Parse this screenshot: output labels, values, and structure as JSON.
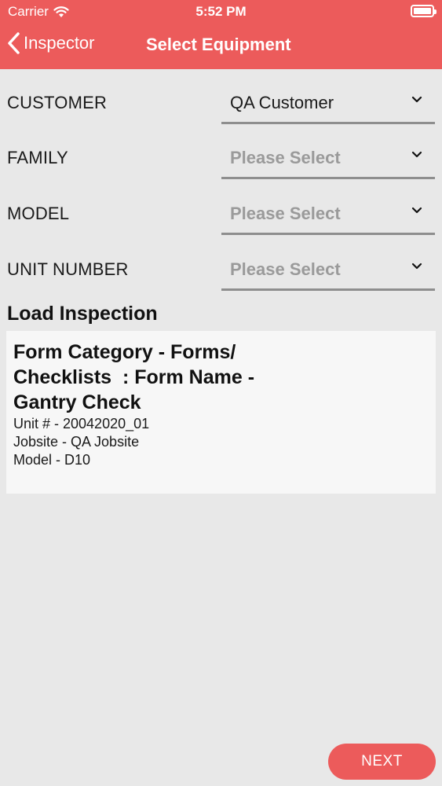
{
  "status_bar": {
    "carrier": "Carrier",
    "time": "5:52 PM",
    "icons": [
      "wifi-icon",
      "battery-icon"
    ]
  },
  "nav": {
    "back_label": "Inspector",
    "title": "Select Equipment"
  },
  "form": {
    "fields": [
      {
        "label": "CUSTOMER",
        "value": "QA Customer",
        "state": "filled"
      },
      {
        "label": "FAMILY",
        "value": "Please Select",
        "state": "placeholder"
      },
      {
        "label": "MODEL",
        "value": "Please Select",
        "state": "placeholder"
      },
      {
        "label": "UNIT NUMBER",
        "value": "Please Select",
        "state": "placeholder"
      }
    ]
  },
  "load_inspection": {
    "title": "Load Inspection",
    "card": {
      "heading": "Form Category - Forms/\nChecklists  : Form Name -\nGantry Check",
      "lines": [
        "Unit # - 20042020_01",
        "Jobsite - QA Jobsite",
        "Model - D10"
      ]
    }
  },
  "actions": {
    "next_label": "NEXT"
  },
  "colors": {
    "accent": "#ec5b5b",
    "background": "#e8e8e8",
    "card": "#f7f7f7",
    "placeholder": "#9a9a9a"
  }
}
